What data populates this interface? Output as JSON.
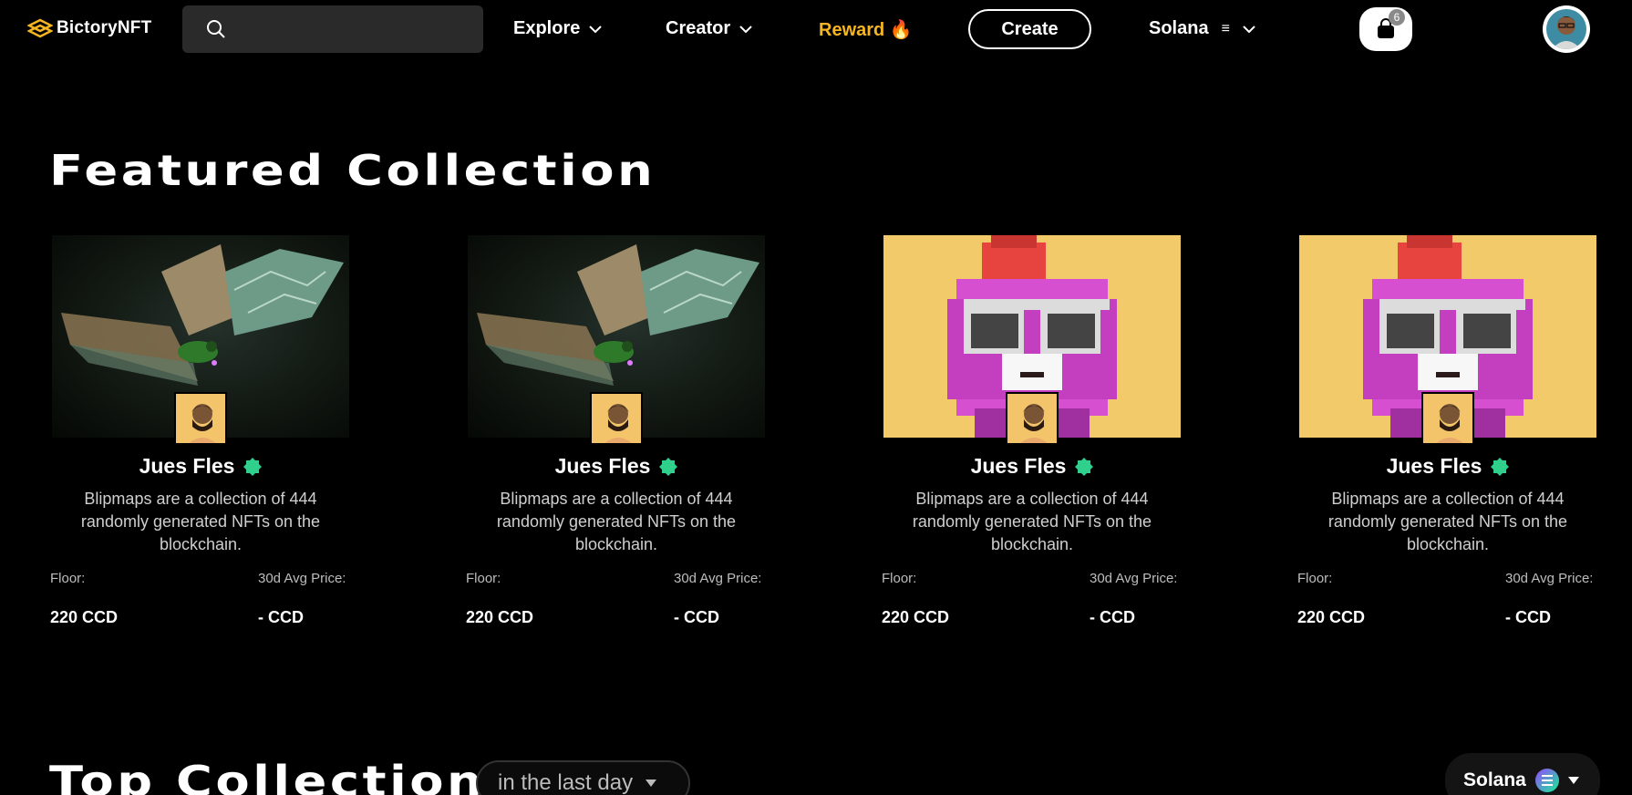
{
  "header": {
    "brand": "BictoryNFT",
    "search": {
      "placeholder": "",
      "value": ""
    },
    "nav": {
      "explore": "Explore",
      "creator": "Creator",
      "reward": "Reward 🔥"
    },
    "create_label": "Create",
    "chain": "Solana",
    "chain_menu_glyph": "≡",
    "cart_count": "6"
  },
  "featured": {
    "title": "Featured Collection",
    "cards": [
      {
        "name": "Jues Fles",
        "description": "Blipmaps are a collection of 444 randomly generated NFTs on the blockchain.",
        "floor_label": "Floor:",
        "floor_value": "220 CCD",
        "avg_label": "30d Avg Price:",
        "avg_value": "- CCD",
        "image": "dragonfly"
      },
      {
        "name": "Jues Fles",
        "description": "Blipmaps are a collection of 444 randomly generated NFTs on the blockchain.",
        "floor_label": "Floor:",
        "floor_value": "220 CCD",
        "avg_label": "30d Avg Price:",
        "avg_value": "- CCD",
        "image": "dragonfly"
      },
      {
        "name": "Jues Fles",
        "description": "Blipmaps are a collection of 444 randomly generated NFTs on the blockchain.",
        "floor_label": "Floor:",
        "floor_value": "220 CCD",
        "avg_label": "30d Avg Price:",
        "avg_value": "- CCD",
        "image": "pixel-creature"
      },
      {
        "name": "Jues Fles",
        "description": "Blipmaps are a collection of 444 randomly generated NFTs on the blockchain.",
        "floor_label": "Floor:",
        "floor_value": "220 CCD",
        "avg_label": "30d Avg Price:",
        "avg_value": "- CCD",
        "image": "pixel-creature"
      }
    ]
  },
  "top": {
    "title": "Top Collections",
    "period": "in the last day",
    "chain": "Solana"
  },
  "colors": {
    "accent_reward": "#f5b621",
    "verified": "#2fd08b",
    "background": "#000000"
  }
}
